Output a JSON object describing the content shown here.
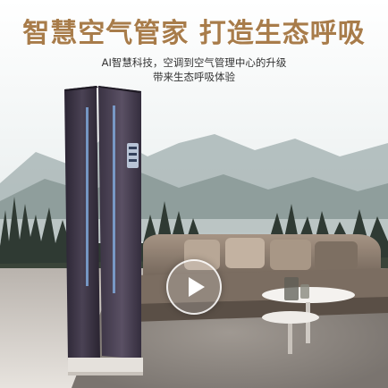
{
  "banner": {
    "headline": "智慧空气管家 打造生态呼吸",
    "subline_1": "AI智慧科技，空调到空气管理中心的升级",
    "subline_2": "带来生态呼吸体验"
  },
  "video": {
    "play_icon": "play-icon"
  },
  "colors": {
    "headline": "#a87c4a",
    "ac_body": "#3a3344",
    "sofa": "#8a7a6c"
  }
}
